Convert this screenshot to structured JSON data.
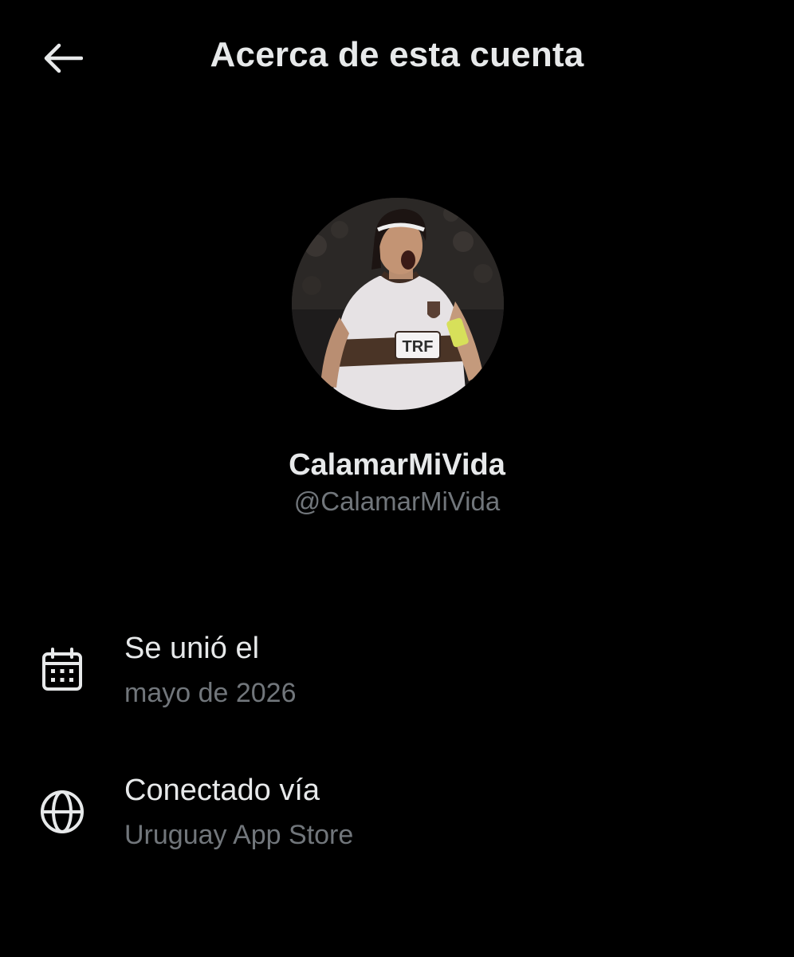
{
  "header": {
    "title": "Acerca de esta cuenta",
    "back_icon": "arrow-left-icon"
  },
  "profile": {
    "display_name": "CalamarMiVida",
    "handle": "@CalamarMiVida",
    "avatar_jersey_text": "TRF"
  },
  "details": {
    "joined": {
      "icon": "calendar-icon",
      "label": "Se unió el",
      "value": "mayo de 2026"
    },
    "connected": {
      "icon": "globe-icon",
      "label": "Conectado vía",
      "value": "Uruguay App Store"
    }
  },
  "colors": {
    "background": "#000000",
    "primary_text": "#e7e9ea",
    "secondary_text": "#71767b"
  }
}
